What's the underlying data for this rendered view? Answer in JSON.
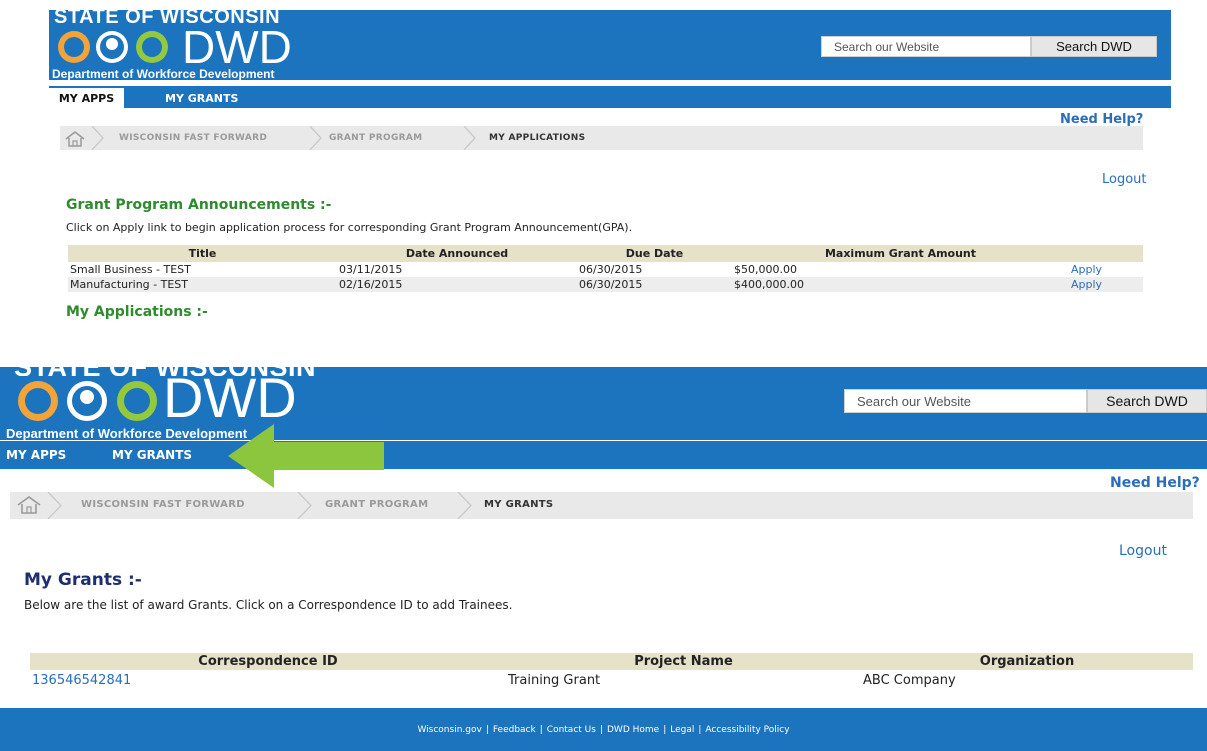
{
  "top": {
    "brand": {
      "state": "STATE OF WISCONSIN",
      "dwd": "DWD",
      "department": "Department of Workforce Development"
    },
    "search": {
      "placeholder": "Search our Website",
      "button": "Search DWD"
    },
    "nav": {
      "my_apps": "MY APPS",
      "my_grants": "MY GRANTS"
    },
    "breadcrumb": [
      "WISCONSIN FAST FORWARD",
      "GRANT PROGRAM",
      "MY APPLICATIONS"
    ],
    "need_help": "Need Help?",
    "logout": "Logout",
    "announcements_heading": "Grant Program Announcements :-",
    "announcements_desc": "Click on Apply link to begin application process for corresponding Grant Program Announcement(GPA).",
    "table": {
      "headers": [
        "Title",
        "Date Announced",
        "Due Date",
        "Maximum Grant Amount",
        ""
      ],
      "rows": [
        [
          "Small Business - TEST",
          "03/11/2015",
          "06/30/2015",
          "$50,000.00",
          "Apply"
        ],
        [
          "Manufacturing - TEST",
          "02/16/2015",
          "06/30/2015",
          "$400,000.00",
          "Apply"
        ]
      ]
    },
    "applications_heading": "My Applications :-"
  },
  "bottom": {
    "brand": {
      "state": "STATE OF WISCONSIN",
      "dwd": "DWD",
      "department": "Department of Workforce Development"
    },
    "search": {
      "placeholder": "Search our Website",
      "button": "Search DWD"
    },
    "nav": {
      "my_apps": "MY APPS",
      "my_grants": "MY GRANTS"
    },
    "breadcrumb": [
      "WISCONSIN FAST FORWARD",
      "GRANT PROGRAM",
      "MY GRANTS"
    ],
    "need_help": "Need Help?",
    "logout": "Logout",
    "grants_heading": "My Grants :-",
    "grants_desc": "Below are the list of award Grants. Click on a Correspondence ID to add Trainees.",
    "table": {
      "headers": [
        "Correspondence ID",
        "Project Name",
        "Organization"
      ],
      "rows": [
        [
          "136546542841",
          "Training Grant",
          "ABC Company"
        ]
      ]
    },
    "footer": {
      "links": [
        "Wisconsin.gov",
        "Feedback",
        "Contact Us",
        "DWD Home",
        "Legal",
        "Accessibility Policy"
      ],
      "separator": "|"
    }
  },
  "colors": {
    "header_blue": "#1b74bd",
    "heading_green": "#2e8b2e",
    "heading_navy": "#1d2f6f",
    "link_blue": "#2a6ebb",
    "table_header": "#e5e2c9",
    "arrow_green": "#8cc63f"
  },
  "icons": {
    "home": "home-icon",
    "arrow": "left-arrow-icon"
  }
}
